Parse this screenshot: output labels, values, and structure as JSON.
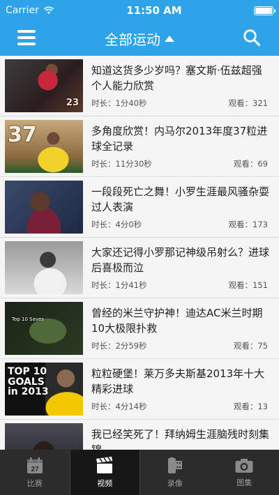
{
  "status": {
    "carrier": "Carrier",
    "time": "11:50 AM"
  },
  "nav": {
    "title": "全部运动"
  },
  "videos": [
    {
      "title": "知道这货多少岁吗？塞文斯·伍兹超强个人能力欣赏",
      "duration": "时长：1分40秒",
      "views": "观看：321",
      "thumb_text": ""
    },
    {
      "title": "多角度欣赏！内马尔2013年度37粒进球全记录",
      "duration": "时长：11分30秒",
      "views": "观看：69",
      "thumb_text": "37"
    },
    {
      "title": "一段段死亡之舞！小罗生涯最风骚杂耍过人表演",
      "duration": "时长：4分0秒",
      "views": "观看：173",
      "thumb_text": ""
    },
    {
      "title": "大家还记得小罗那记神级吊射么？进球后喜极而泣",
      "duration": "时长：1分41秒",
      "views": "观看：151",
      "thumb_text": ""
    },
    {
      "title": "曾经的米兰守护神！迪达AC米兰时期10大极限扑救",
      "duration": "时长：2分59秒",
      "views": "观看：75",
      "thumb_text": "Top 10 Saves"
    },
    {
      "title": "粒粒硬堡！莱万多夫斯基2013年十大精彩进球",
      "duration": "时长：4分14秒",
      "views": "观看：13",
      "thumb_text": "TOP 10 GOALS in 2013"
    },
    {
      "title": "我已经笑死了！拜纳姆生涯脑残时刻集锦",
      "duration": "",
      "views": "",
      "thumb_text": ""
    }
  ],
  "tabs": [
    {
      "label": "比赛",
      "icon": "calendar-icon",
      "badge": "27",
      "active": false
    },
    {
      "label": "视频",
      "icon": "clapperboard-icon",
      "active": true
    },
    {
      "label": "录像",
      "icon": "film-roll-icon",
      "active": false
    },
    {
      "label": "图集",
      "icon": "camera-icon",
      "active": false
    }
  ],
  "colors": {
    "header": "#2ea3ea",
    "tabbar": "#2c2c2c"
  }
}
